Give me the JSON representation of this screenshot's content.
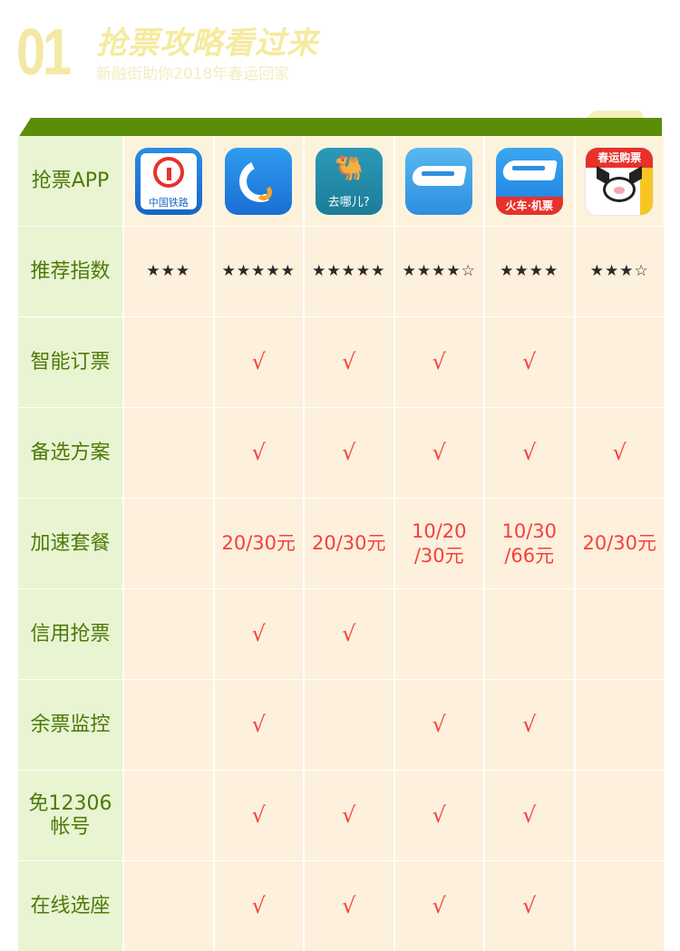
{
  "header": {
    "number": "01",
    "title": "抢票攻略看过来",
    "subtitle": "新融街助你2018年春运回家"
  },
  "colors": {
    "label_green": "#4e7a06",
    "band_green": "#5a8d08",
    "value_red": "#f4413c",
    "cell_cream": "#fdf0dd",
    "cell_green": "#e9f4d3"
  },
  "row_labels": [
    "抢票APP",
    "推荐指数",
    "智能订票",
    "备选方案",
    "加速套餐",
    "信用抢票",
    "余票监控",
    "免12306\n帐号",
    "在线选座"
  ],
  "apps": [
    {
      "icon": "china-railway-icon",
      "icon_text": "中国铁路"
    },
    {
      "icon": "ctrip-dolphin-icon",
      "icon_text": ""
    },
    {
      "icon": "qunar-camel-icon",
      "icon_text": "去哪儿?"
    },
    {
      "icon": "zhixing-train-icon",
      "icon_text": ""
    },
    {
      "icon": "gaotie-train-icon",
      "icon_text": "火车·机票"
    },
    {
      "icon": "feizhu-pig-icon",
      "icon_text": "春运购票"
    }
  ],
  "ratings": [
    "★★★",
    "★★★★★",
    "★★★★★",
    "★★★★☆",
    "★★★★",
    "★★★☆"
  ],
  "check_symbol": "√",
  "features": {
    "smart_booking": [
      "",
      "√",
      "√",
      "√",
      "√",
      ""
    ],
    "alternatives": [
      "",
      "√",
      "√",
      "√",
      "√",
      "√"
    ],
    "speed_packages": [
      "",
      "20/30元",
      "20/30元",
      "10/20\n/30元",
      "10/30\n/66元",
      "20/30元"
    ],
    "credit_grab": [
      "",
      "√",
      "√",
      "",
      "",
      ""
    ],
    "ticket_monitor": [
      "",
      "√",
      "",
      "√",
      "√",
      ""
    ],
    "no_12306_account": [
      "",
      "√",
      "√",
      "√",
      "√",
      ""
    ],
    "online_seat": [
      "",
      "√",
      "√",
      "√",
      "√",
      ""
    ]
  }
}
